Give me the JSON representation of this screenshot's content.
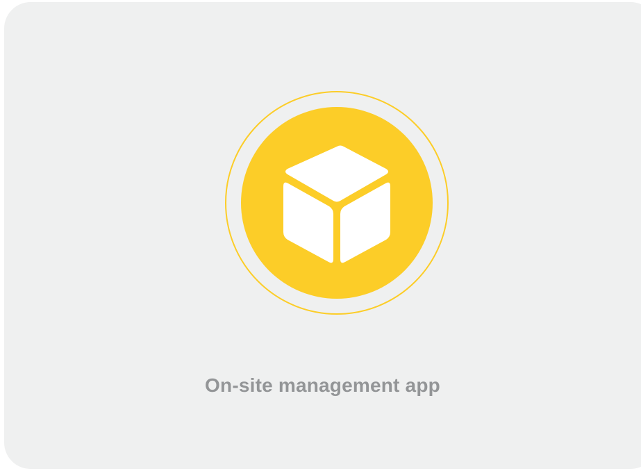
{
  "app_tile": {
    "title": "On-site management app",
    "icon": "cube-icon",
    "accent_color": "#fccd28",
    "background_color": "#eff0f0",
    "text_color": "#939597"
  }
}
